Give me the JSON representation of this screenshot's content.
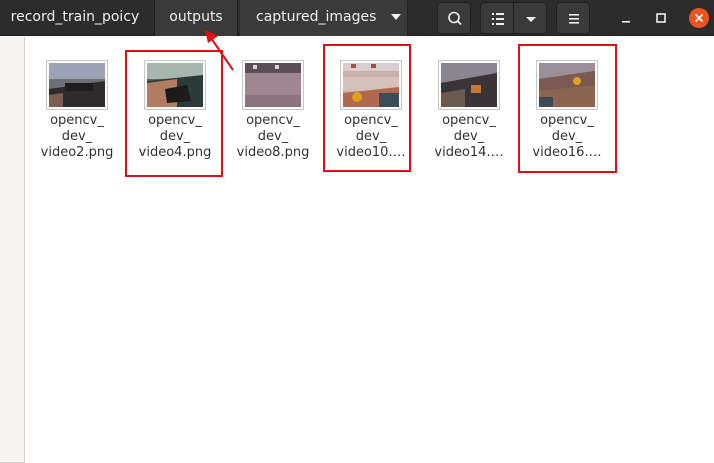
{
  "header": {
    "breadcrumbs": [
      "record_train_poicy",
      "outputs",
      "captured_images"
    ]
  },
  "files": [
    {
      "line1": "opencv_",
      "line2": "dev_",
      "line3": "video2.png",
      "highlighted": false
    },
    {
      "line1": "opencv_",
      "line2": "dev_",
      "line3": "video4.png",
      "highlighted": true
    },
    {
      "line1": "opencv_",
      "line2": "dev_",
      "line3": "video8.png",
      "highlighted": false
    },
    {
      "line1": "opencv_",
      "line2": "dev_",
      "line3": "video10.…",
      "highlighted": true
    },
    {
      "line1": "opencv_",
      "line2": "dev_",
      "line3": "video14.…",
      "highlighted": false
    },
    {
      "line1": "opencv_",
      "line2": "dev_",
      "line3": "video16.…",
      "highlighted": true
    }
  ],
  "icons": {
    "search": "search-icon",
    "view": "list-view-icon",
    "view_menu": "chevron-down-icon",
    "menu": "hamburger-menu-icon",
    "minimize": "minimize-icon",
    "maximize": "maximize-icon",
    "close": "close-icon"
  },
  "colors": {
    "highlight": "#dd1111",
    "header_bg": "#2c2c2c",
    "close_bg": "#e95420"
  }
}
